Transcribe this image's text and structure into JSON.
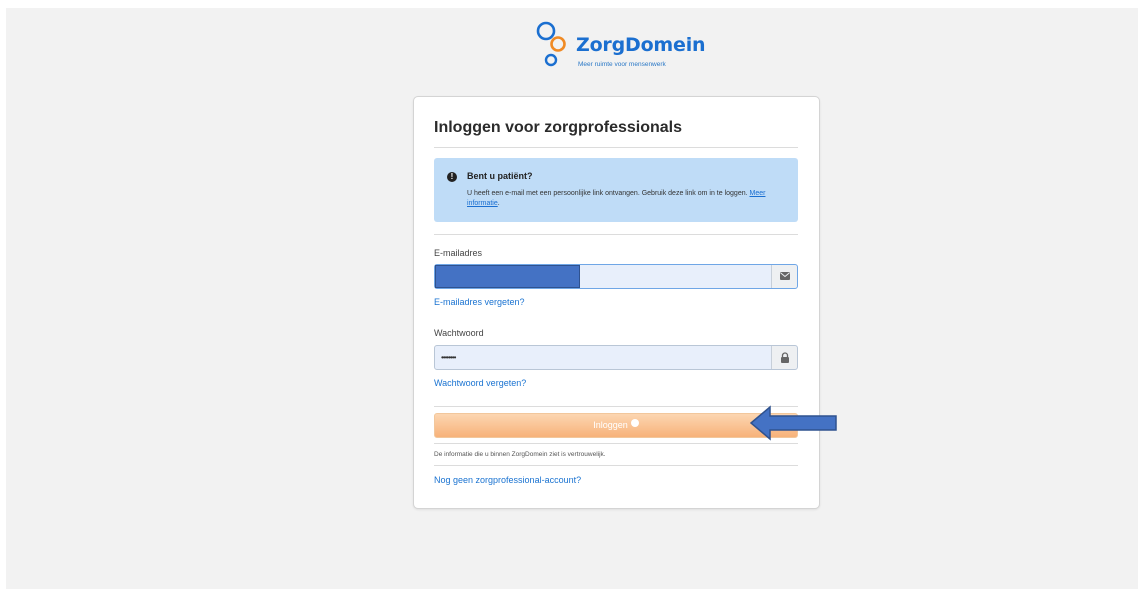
{
  "logo": {
    "name": "ZorgDomein",
    "tagline": "Meer ruimte voor mensenwerk"
  },
  "card": {
    "title": "Inloggen voor zorgprofessionals"
  },
  "alert": {
    "icon": "info-icon",
    "title": "Bent u patiënt?",
    "text": "U heeft een e-mail met een persoonlijke link ontvangen. Gebruik deze link om in te loggen.",
    "link": "Meer informatie"
  },
  "email": {
    "label": "E-mailadres",
    "icon": "envelope-icon",
    "forgot": "E-mailadres vergeten?"
  },
  "password": {
    "label": "Wachtwoord",
    "value": "••••••••",
    "icon": "lock-icon",
    "forgot": "Wachtwoord vergeten?"
  },
  "login": {
    "label": "Inloggen"
  },
  "note": "De informatie die u binnen ZorgDomein ziet is vertrouwelijk.",
  "signup": "Nog geen zorgprofessional-account?",
  "colors": {
    "brand_blue": "#1b6fd0",
    "brand_orange": "#f08a24",
    "alert_bg": "#bfdcf7",
    "button_orange": "#f7b27a",
    "arrow_fill": "#4472c4"
  }
}
